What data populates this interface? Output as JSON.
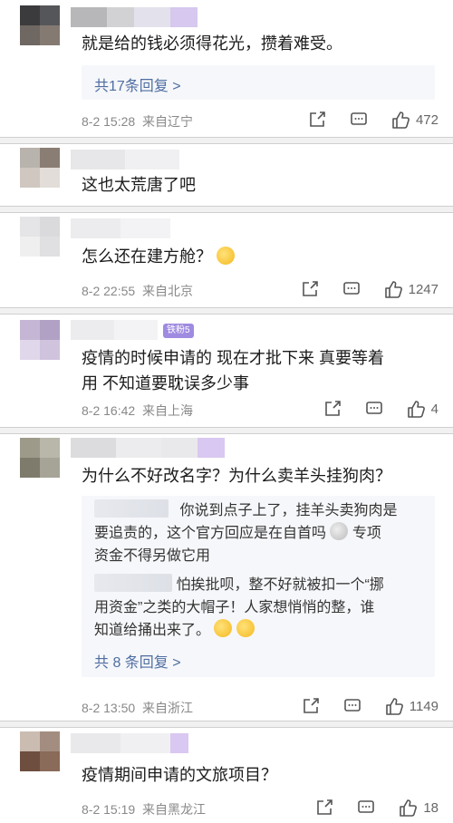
{
  "comments": [
    {
      "text": "就是给的钱必须得花光，攒着难受。",
      "replies_more": "共17条回复 >",
      "date": "8-2 15:28",
      "location": "来自辽宁",
      "likes": "472"
    },
    {
      "text": "这也太荒唐了吧"
    },
    {
      "text": "怎么还在建方舱？",
      "date": "8-2 22:55",
      "location": "来自北京",
      "likes": "1247"
    },
    {
      "badge": "铁粉5",
      "text_line1": "疫情的时候申请的 现在才批下来 真要等着",
      "text_line2": "用 不知道要耽误多少事",
      "date": "8-2 16:42",
      "location": "来自上海",
      "likes": "4"
    },
    {
      "text": "为什么不好改名字？为什么卖羊头挂狗肉？",
      "reply1_line1": "你说到点子上了，挂羊头卖狗肉是",
      "reply1_line2": "要追责的，这个官方回应是在自首吗",
      "reply1_line2b": "专项",
      "reply1_line3": "资金不得另做它用",
      "reply2_line1": "怕挨批呗，整不好就被扣一个“挪",
      "reply2_line2": "用资金”之类的大帽子！人家想悄悄的整，谁",
      "reply2_line3": "知道给捅出来了。",
      "replies_more": "共 8 条回复 >",
      "date": "8-2 13:50",
      "location": "来自浙江",
      "likes": "1149"
    },
    {
      "text": "疫情期间申请的文旅项目？",
      "date": "8-2 15:19",
      "location": "来自黑龙江",
      "likes": "18"
    }
  ]
}
